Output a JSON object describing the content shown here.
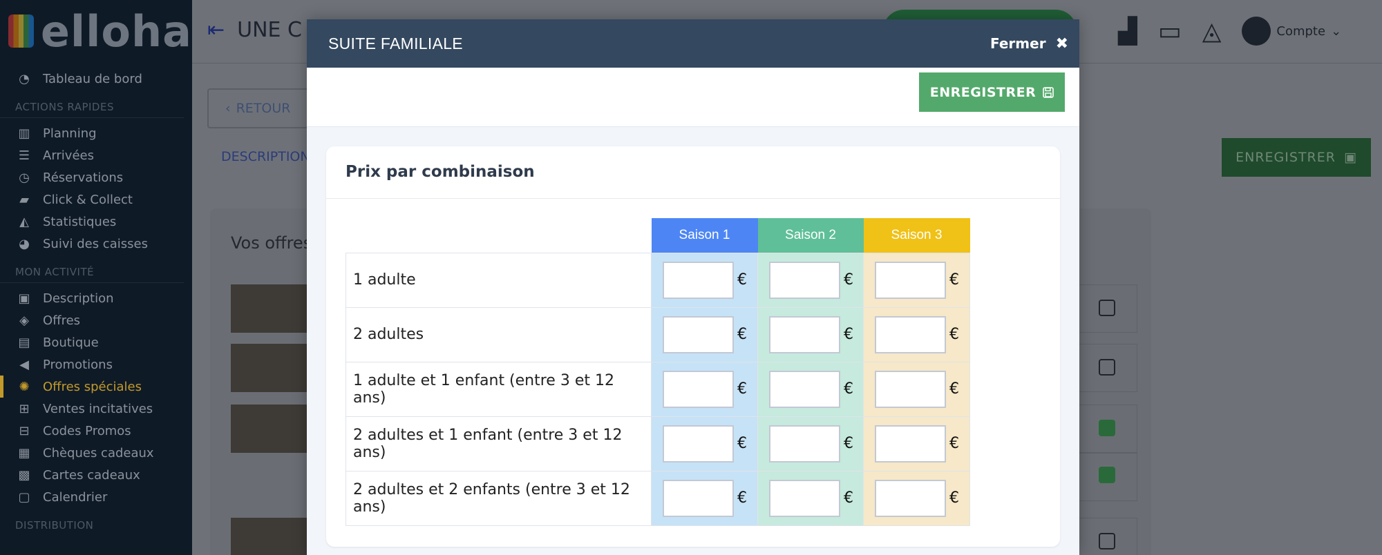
{
  "app": {
    "logo_text": "elloha",
    "page_title": "UNE C"
  },
  "sidebar": {
    "top_items": [
      {
        "label": "Tableau de bord",
        "icon": "dashboard-icon"
      }
    ],
    "sections": [
      {
        "title": "ACTIONS RAPIDES",
        "items": [
          {
            "label": "Planning",
            "icon": "bar-chart-icon"
          },
          {
            "label": "Arrivées",
            "icon": "sliders-icon"
          },
          {
            "label": "Réservations",
            "icon": "clock-icon"
          },
          {
            "label": "Click & Collect",
            "icon": "car-icon"
          },
          {
            "label": "Statistiques",
            "icon": "area-chart-icon"
          },
          {
            "label": "Suivi des caisses",
            "icon": "pie-chart-icon"
          }
        ]
      },
      {
        "title": "MON ACTIVITÉ",
        "items": [
          {
            "label": "Description",
            "icon": "briefcase-icon"
          },
          {
            "label": "Offres",
            "icon": "tags-icon"
          },
          {
            "label": "Boutique",
            "icon": "shopping-bag-icon"
          },
          {
            "label": "Promotions",
            "icon": "megaphone-icon"
          },
          {
            "label": "Offres spéciales",
            "icon": "badge-icon",
            "active": true
          },
          {
            "label": "Ventes incitatives",
            "icon": "cart-plus-icon"
          },
          {
            "label": "Codes Promos",
            "icon": "cart-icon"
          },
          {
            "label": "Chèques cadeaux",
            "icon": "newspaper-icon"
          },
          {
            "label": "Cartes cadeaux",
            "icon": "gift-icon"
          },
          {
            "label": "Calendrier",
            "icon": "calendar-icon"
          }
        ]
      },
      {
        "title": "DISTRIBUTION",
        "items": []
      }
    ]
  },
  "header": {
    "account_label": "Compte"
  },
  "background": {
    "back_label": "RETOUR",
    "tab_label": "DESCRIPTION",
    "save_label": "ENREGISTRER",
    "panel_title": "Vos offres"
  },
  "modal": {
    "title": "SUITE FAMILIALE",
    "close_label": "Fermer",
    "save_label": "ENREGISTRER",
    "card_title": "Prix par combinaison",
    "currency": "€",
    "columns": [
      "Saison 1",
      "Saison 2",
      "Saison 3"
    ],
    "column_colors": [
      "#4d86f4",
      "#5fbf98",
      "#f0c116"
    ],
    "rows": [
      {
        "label": "1 adulte",
        "values": [
          "",
          "",
          ""
        ]
      },
      {
        "label": "2 adultes",
        "values": [
          "",
          "",
          ""
        ]
      },
      {
        "label": "1 adulte et 1 enfant (entre 3 et 12 ans)",
        "values": [
          "",
          "",
          ""
        ]
      },
      {
        "label": "2 adultes et 1 enfant (entre 3 et 12 ans)",
        "values": [
          "",
          "",
          ""
        ]
      },
      {
        "label": "2 adultes et 2 enfants (entre 3 et 12 ans)",
        "values": [
          "",
          "",
          ""
        ]
      }
    ]
  }
}
